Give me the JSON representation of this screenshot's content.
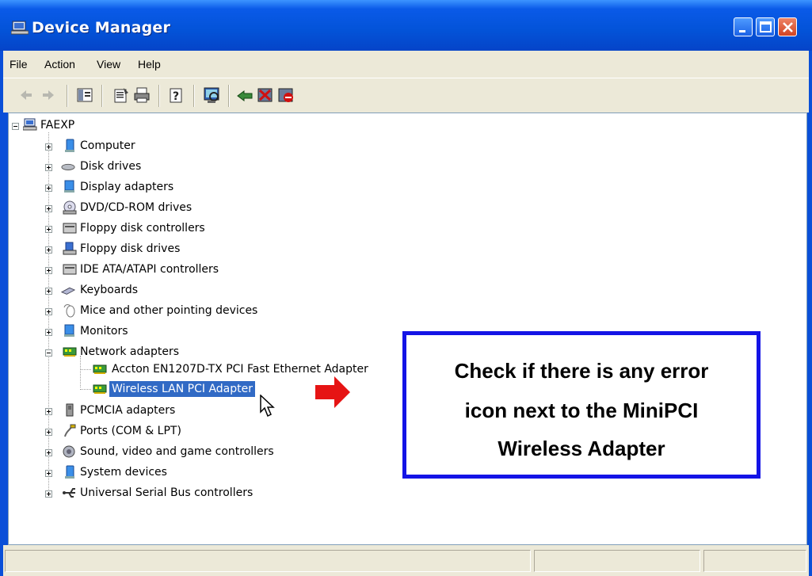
{
  "window": {
    "title": "Device Manager"
  },
  "menu": [
    "File",
    "Action",
    "View",
    "Help"
  ],
  "toolbar": {
    "icons": [
      "back-icon",
      "forward-icon",
      "show-hide-tree-icon",
      "properties-icon",
      "print-icon",
      "help-icon",
      "scan-hardware-icon",
      "update-driver-icon",
      "uninstall-icon",
      "disable-icon"
    ]
  },
  "tree": {
    "root": "FAEXP",
    "items": [
      {
        "label": "Computer",
        "icon": "computer-icon"
      },
      {
        "label": "Disk drives",
        "icon": "disk-drive-icon"
      },
      {
        "label": "Display adapters",
        "icon": "display-adapter-icon"
      },
      {
        "label": "DVD/CD-ROM drives",
        "icon": "dvd-drive-icon"
      },
      {
        "label": "Floppy disk controllers",
        "icon": "floppy-controller-icon"
      },
      {
        "label": "Floppy disk drives",
        "icon": "floppy-drive-icon"
      },
      {
        "label": "IDE ATA/ATAPI controllers",
        "icon": "ide-controller-icon"
      },
      {
        "label": "Keyboards",
        "icon": "keyboard-icon"
      },
      {
        "label": "Mice and other pointing devices",
        "icon": "mouse-icon"
      },
      {
        "label": "Monitors",
        "icon": "monitor-icon"
      },
      {
        "label": "Network adapters",
        "icon": "network-adapter-icon"
      },
      {
        "label": "PCMCIA adapters",
        "icon": "pcmcia-icon"
      },
      {
        "label": "Ports (COM & LPT)",
        "icon": "port-icon"
      },
      {
        "label": "Sound, video and game controllers",
        "icon": "sound-icon"
      },
      {
        "label": "System devices",
        "icon": "system-device-icon"
      },
      {
        "label": "Universal Serial Bus controllers",
        "icon": "usb-icon"
      }
    ],
    "network_children": [
      {
        "label": "Accton EN1207D-TX PCI Fast Ethernet Adapter"
      },
      {
        "label": "Wireless LAN PCI Adapter",
        "selected": true
      }
    ]
  },
  "callout": {
    "lines": [
      "Check if there is any error",
      "icon next to the MiniPCI",
      "Wireless Adapter"
    ],
    "border_color": "#1414e6"
  },
  "colors": {
    "titlebar": "#0353d8",
    "selection": "#316ac5",
    "arrow": "#e61414"
  }
}
